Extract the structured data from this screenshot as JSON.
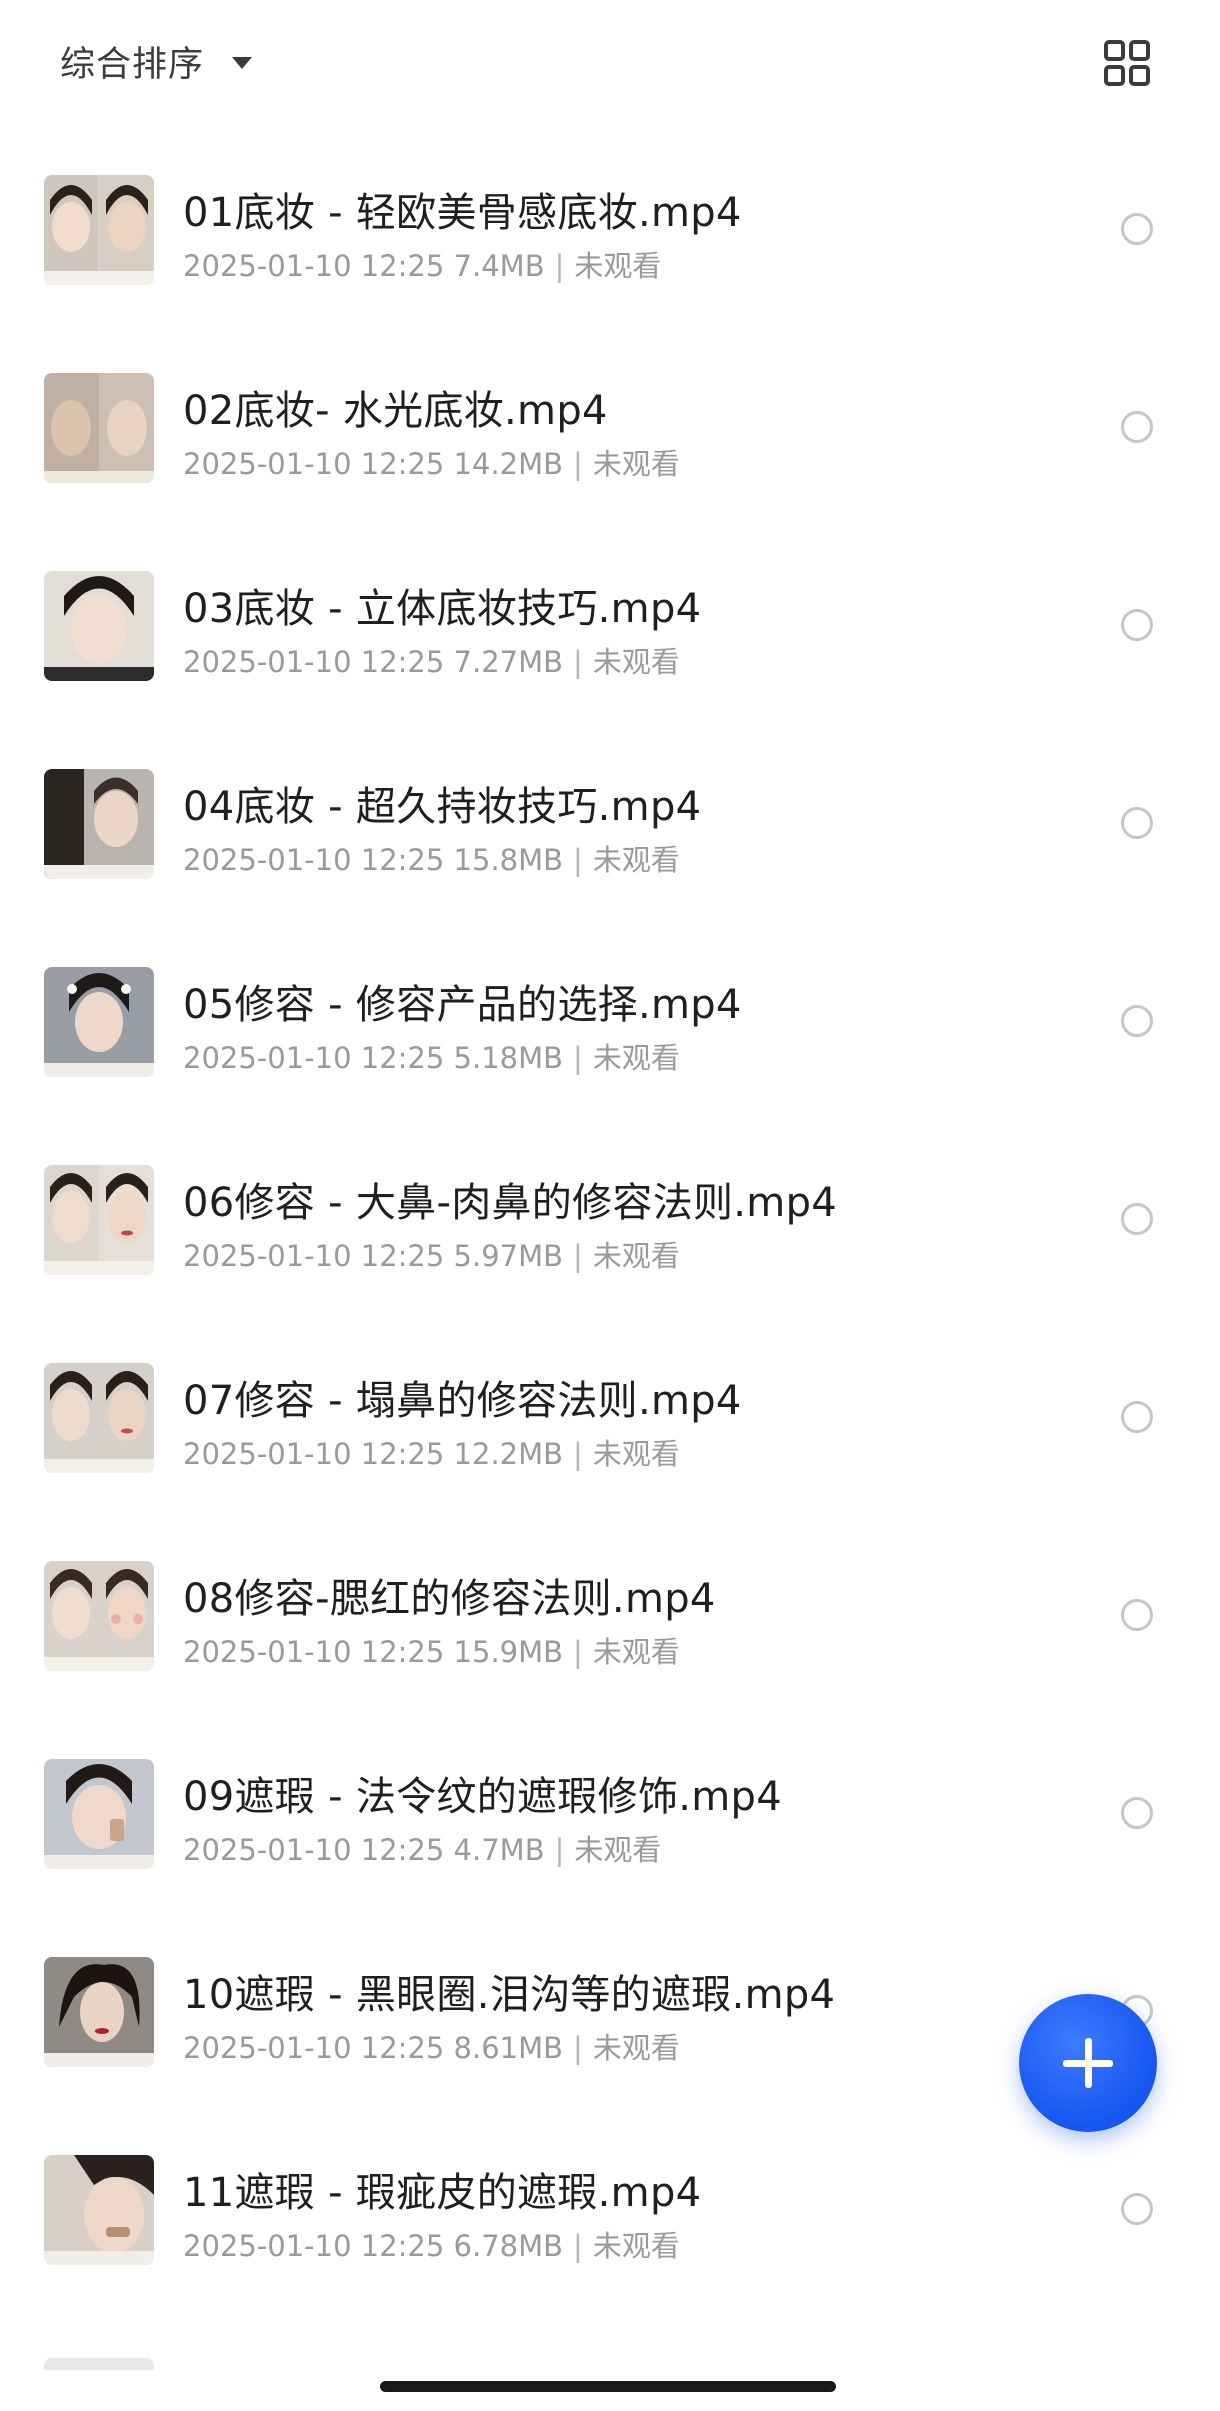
{
  "toolbar": {
    "sort_label": "综合排序",
    "sort_icon": "caret-down-icon",
    "view_toggle_icon": "grid-view-icon"
  },
  "files": [
    {
      "name": "01底妆 - 轻欧美骨感底妆.mp4",
      "date": "2025-01-10 12:25",
      "size": "7.4MB",
      "status": "未观看"
    },
    {
      "name": "02底妆- 水光底妆.mp4",
      "date": "2025-01-10 12:25",
      "size": "14.2MB",
      "status": "未观看"
    },
    {
      "name": "03底妆 - 立体底妆技巧.mp4",
      "date": "2025-01-10 12:25",
      "size": "7.27MB",
      "status": "未观看"
    },
    {
      "name": "04底妆 - 超久持妆技巧.mp4",
      "date": "2025-01-10 12:25",
      "size": "15.8MB",
      "status": "未观看"
    },
    {
      "name": "05修容 - 修容产品的选择.mp4",
      "date": "2025-01-10 12:25",
      "size": "5.18MB",
      "status": "未观看"
    },
    {
      "name": "06修容 - 大鼻-肉鼻的修容法则.mp4",
      "date": "2025-01-10 12:25",
      "size": "5.97MB",
      "status": "未观看"
    },
    {
      "name": "07修容 - 塌鼻的修容法则.mp4",
      "date": "2025-01-10 12:25",
      "size": "12.2MB",
      "status": "未观看"
    },
    {
      "name": "08修容-腮红的修容法则.mp4",
      "date": "2025-01-10 12:25",
      "size": "15.9MB",
      "status": "未观看"
    },
    {
      "name": "09遮瑕 - 法令纹的遮瑕修饰.mp4",
      "date": "2025-01-10 12:25",
      "size": "4.7MB",
      "status": "未观看"
    },
    {
      "name": "10遮瑕 - 黑眼圈.泪沟等的遮瑕.mp4",
      "date": "2025-01-10 12:25",
      "size": "8.61MB",
      "status": "未观看"
    },
    {
      "name": "11遮瑕 - 瑕疵皮的遮瑕.mp4",
      "date": "2025-01-10 12:25",
      "size": "6.78MB",
      "status": "未观看"
    }
  ],
  "fab": {
    "icon": "plus-icon",
    "color": "#1655f0"
  },
  "colors": {
    "radio_border": "#c6c6c6",
    "meta_text": "#9a9a9a",
    "title_text": "#1f1f1f"
  }
}
